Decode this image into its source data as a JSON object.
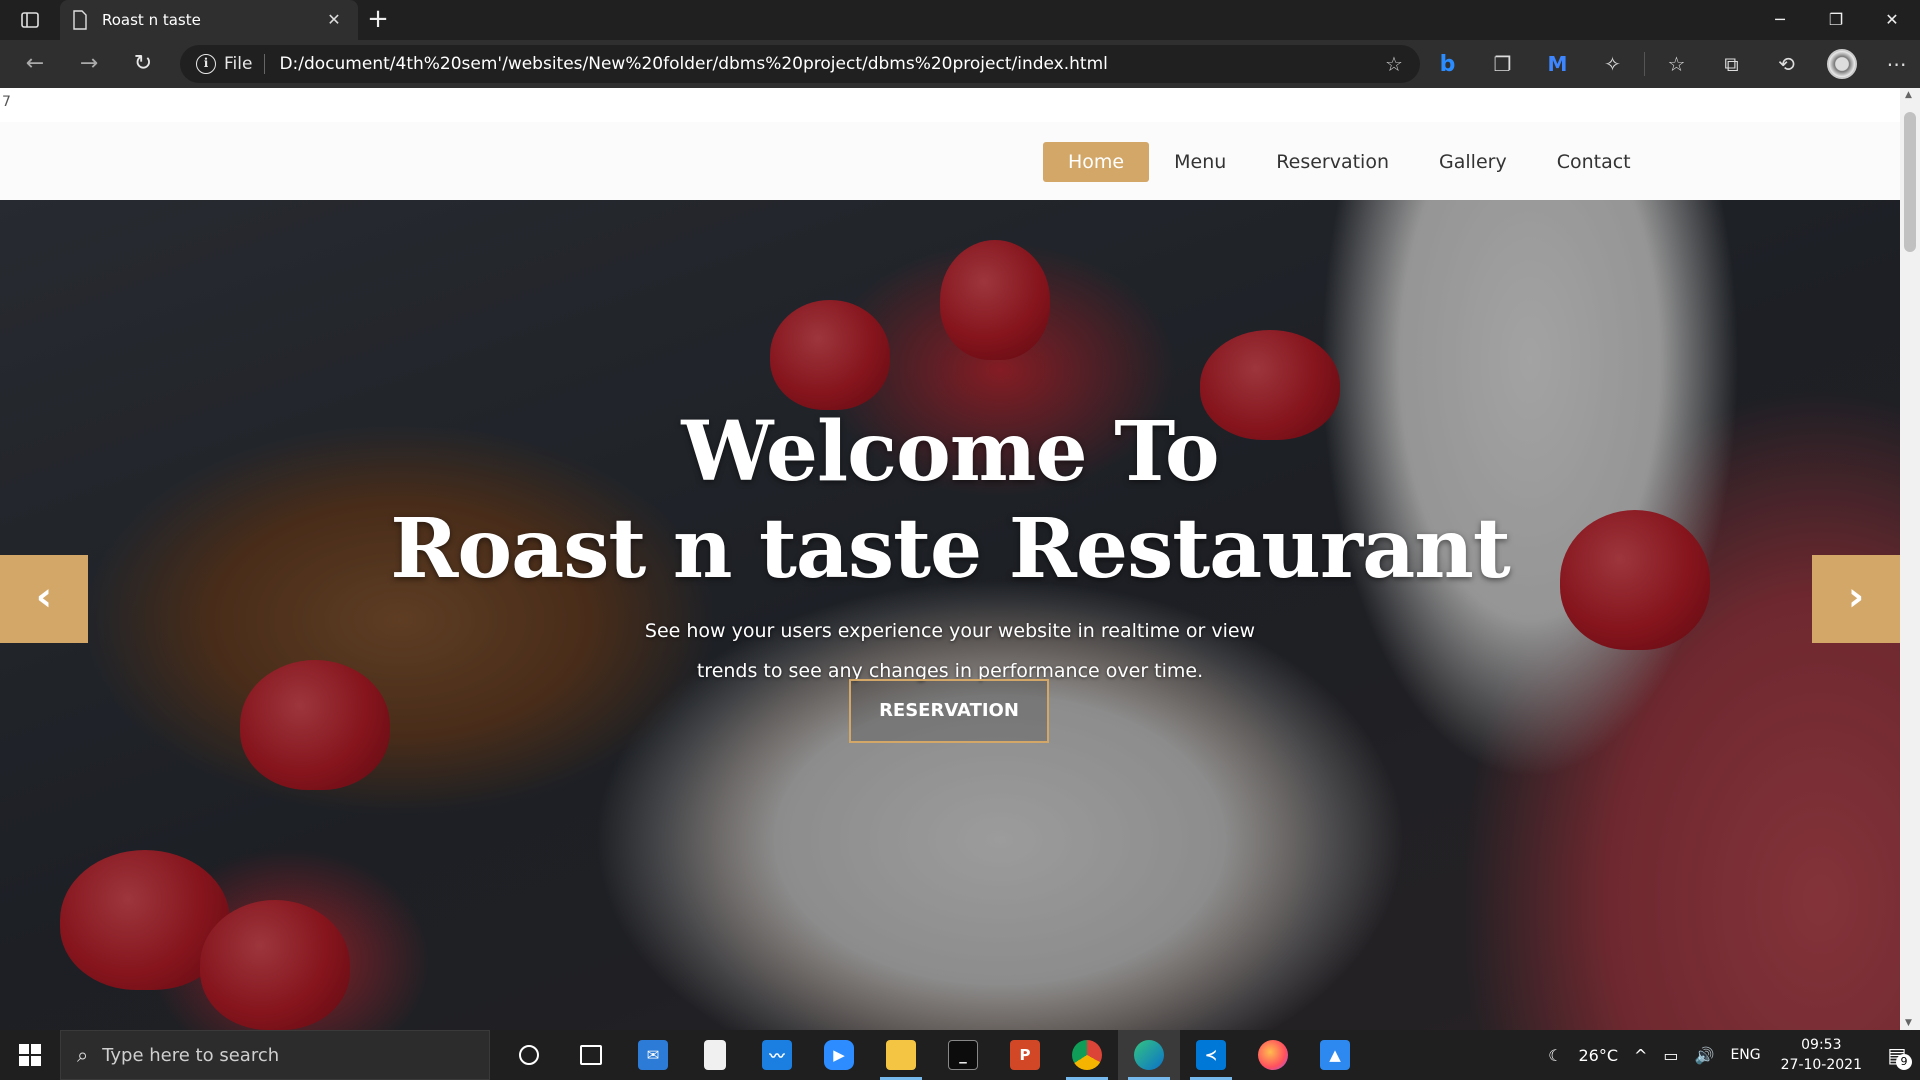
{
  "browser": {
    "tab_title": "Roast n taste",
    "new_tab_symbol": "+",
    "address_scheme": "File",
    "address_url": "D:/document/4th%20sem'/websites/New%20folder/dbms%20project/dbms%20project/index.html"
  },
  "page": {
    "stray_text": "7",
    "nav": {
      "items": [
        {
          "label": "Home",
          "active": true
        },
        {
          "label": "Menu",
          "active": false
        },
        {
          "label": "Reservation",
          "active": false
        },
        {
          "label": "Gallery",
          "active": false
        },
        {
          "label": "Contact",
          "active": false
        }
      ]
    },
    "hero": {
      "title_line1": "Welcome To",
      "title_line2": "Roast n taste Restaurant",
      "subtitle_line1": "See how your users experience your website in realtime or view",
      "subtitle_line2": "trends to see any changes in performance over time.",
      "button_label": "RESERVATION",
      "prev_arrow": "‹",
      "next_arrow": "›"
    },
    "colors": {
      "accent": "#d3a768"
    }
  },
  "taskbar": {
    "search_placeholder": "Type here to search",
    "weather": "26°C",
    "language": "ENG",
    "time": "09:53",
    "date": "27-10-2021",
    "notification_count": "9"
  }
}
